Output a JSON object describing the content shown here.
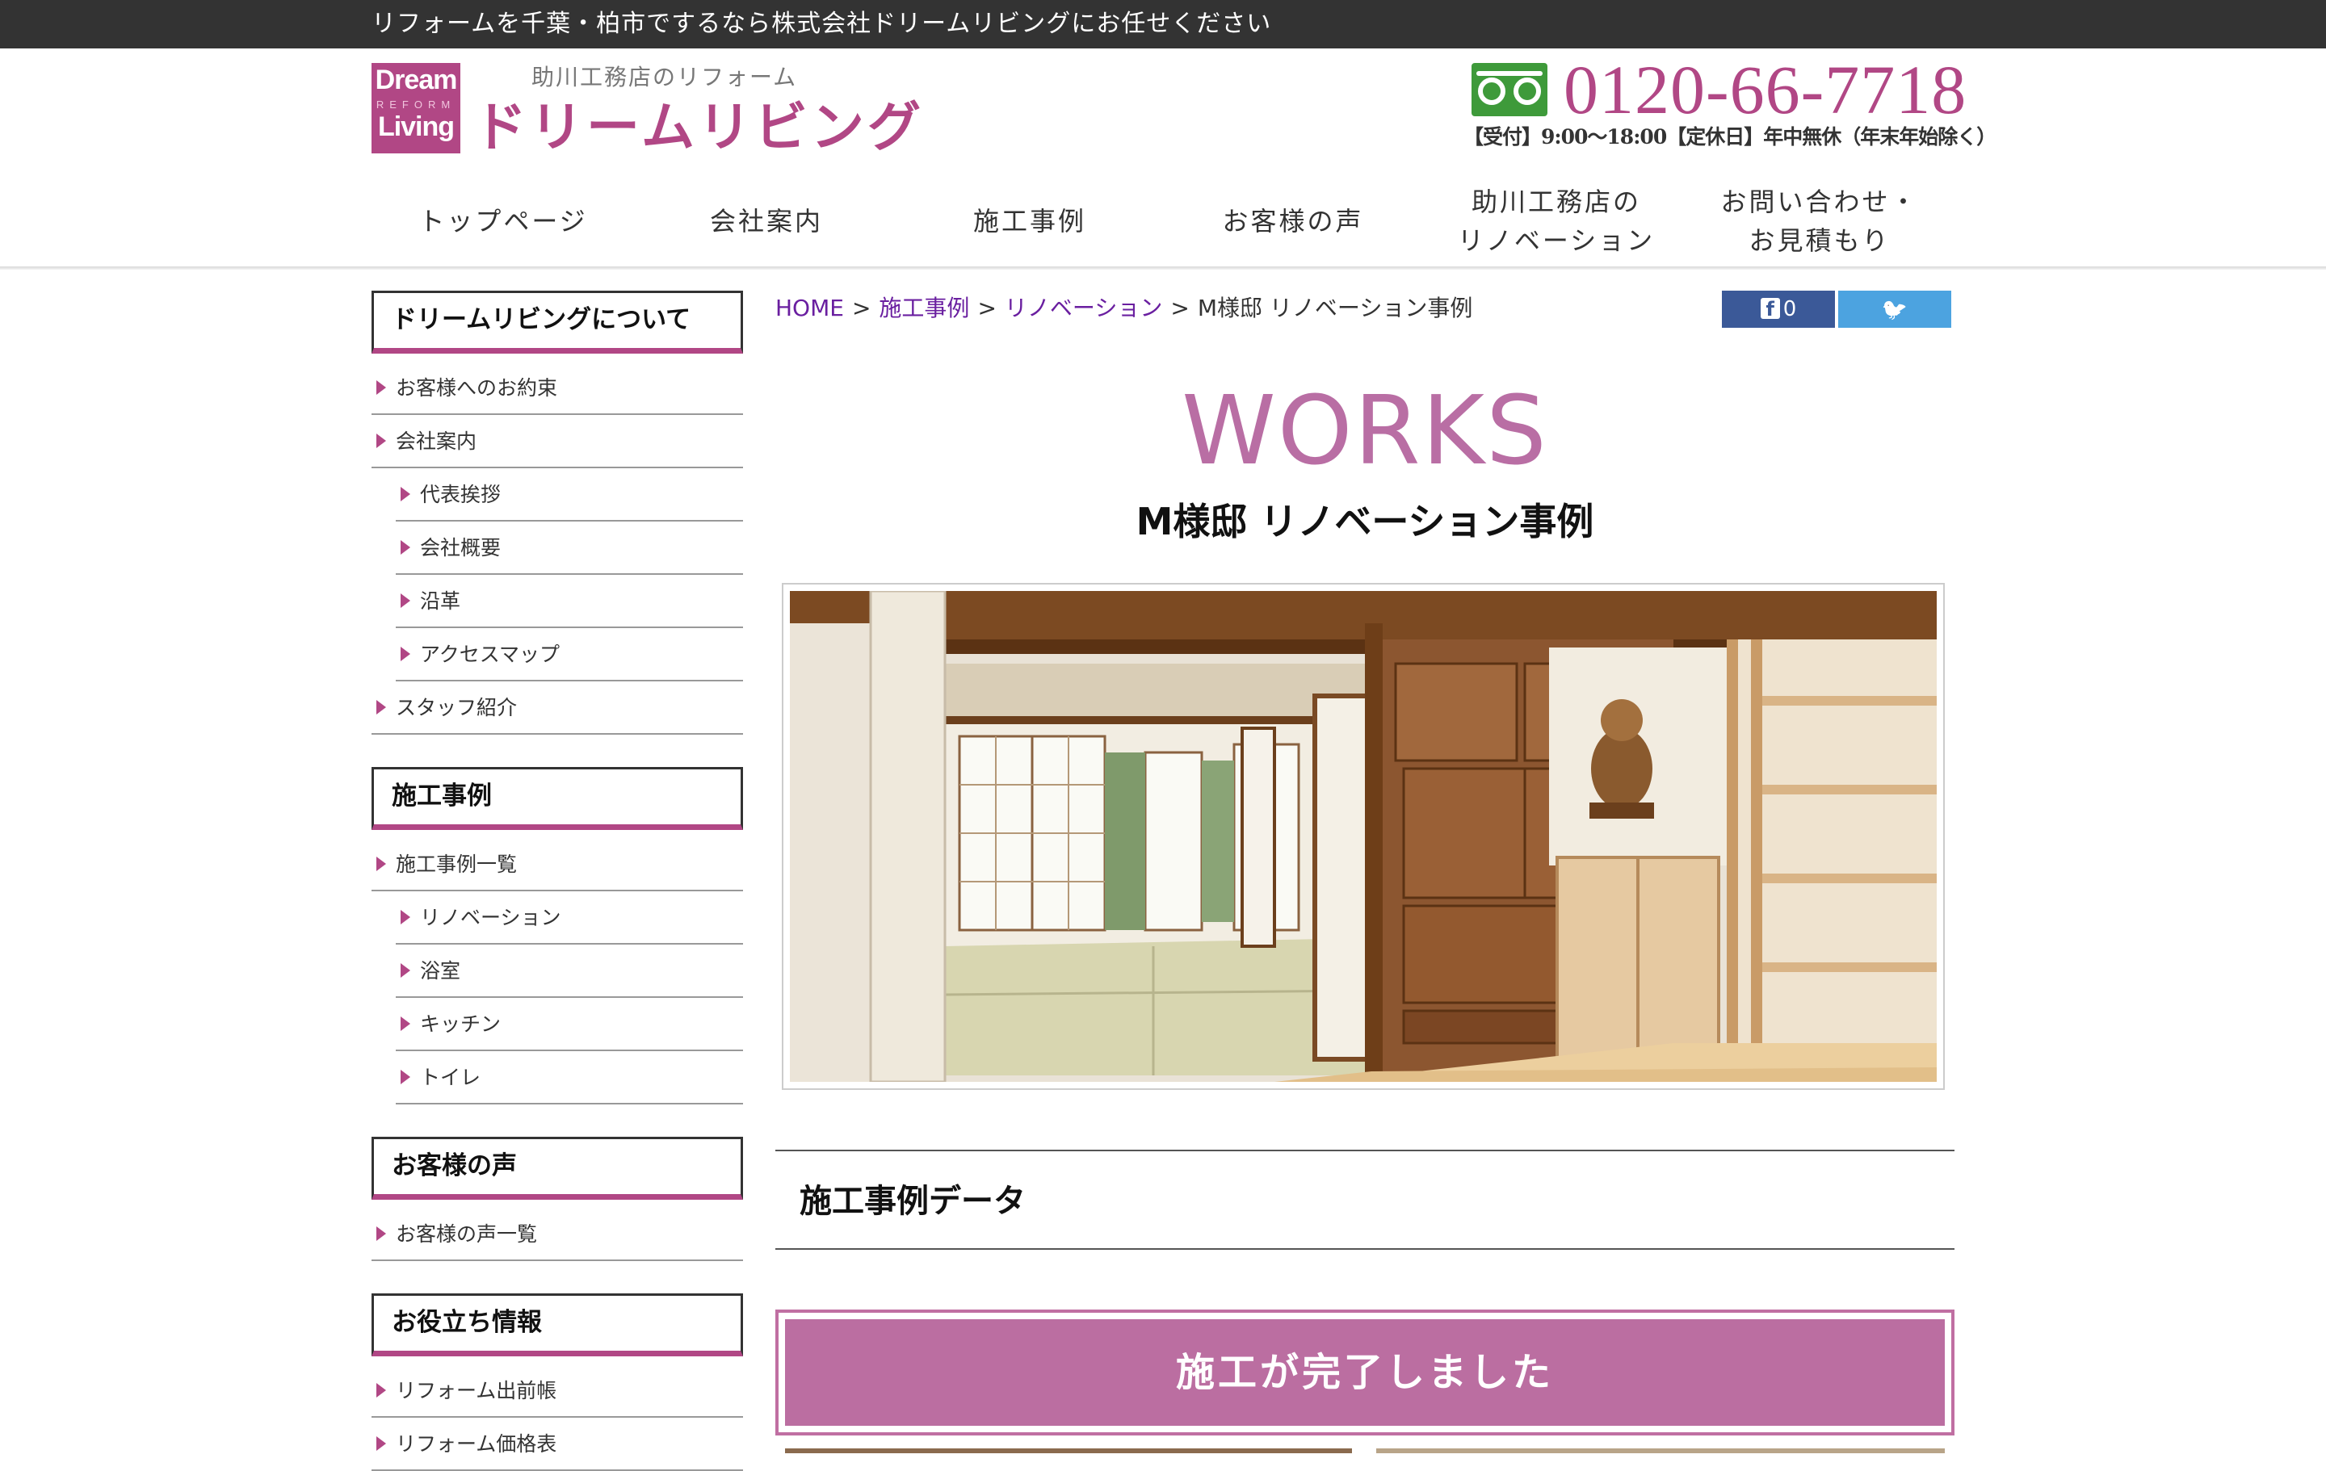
{
  "topbar": {
    "text": "リフォームを千葉・柏市でするなら株式会社ドリームリビングにお任せください"
  },
  "header": {
    "logo_line1": "Dream",
    "logo_reform": "REFORM",
    "logo_line2": "Living",
    "logo_sub": "助川工務店のリフォーム",
    "logo_main": "ドリームリビング",
    "tel_number": "0120-66-7718",
    "tel_hours": "【受付】9:00〜18:00【定休日】年中無休（年末年始除く）"
  },
  "nav": {
    "items": [
      {
        "label": "トップページ"
      },
      {
        "label": "会社案内"
      },
      {
        "label": "施工事例"
      },
      {
        "label": "お客様の声"
      },
      {
        "label": "助川工務店の\nリノベーション"
      },
      {
        "label": "お問い合わせ・\nお見積もり"
      }
    ]
  },
  "sidebar": {
    "sections": [
      {
        "title": "ドリームリビングについて",
        "items": [
          {
            "label": "お客様へのお約束"
          },
          {
            "label": "会社案内"
          },
          {
            "label": "代表挨拶"
          },
          {
            "label": "会社概要"
          },
          {
            "label": "沿革"
          },
          {
            "label": "アクセスマップ"
          },
          {
            "label": "スタッフ紹介"
          }
        ]
      },
      {
        "title": "施工事例",
        "items": [
          {
            "label": "施工事例一覧"
          },
          {
            "label": "リノベーション"
          },
          {
            "label": "浴室"
          },
          {
            "label": "キッチン"
          },
          {
            "label": "トイレ"
          }
        ]
      },
      {
        "title": "お客様の声",
        "items": [
          {
            "label": "お客様の声一覧"
          }
        ]
      },
      {
        "title": "お役立ち情報",
        "items": [
          {
            "label": "リフォーム出前帳"
          },
          {
            "label": "リフォーム価格表"
          }
        ]
      }
    ]
  },
  "breadcrumb": {
    "home": "HOME",
    "works": "施工事例",
    "renovation": "リノベーション",
    "current": "M様邸 リノベーション事例",
    "separator": ">"
  },
  "social": {
    "facebook_count": "0",
    "facebook_glyph": "f",
    "twitter_glyph": "🐦"
  },
  "main": {
    "title": "WORKS",
    "subtitle": "M様邸 リノベーション事例",
    "data_title": "施工事例データ",
    "complete_label": "施工が完了しました"
  },
  "colors": {
    "accent": "#b14785",
    "topbar": "#333333",
    "tel_green": "#3e9a3a"
  }
}
